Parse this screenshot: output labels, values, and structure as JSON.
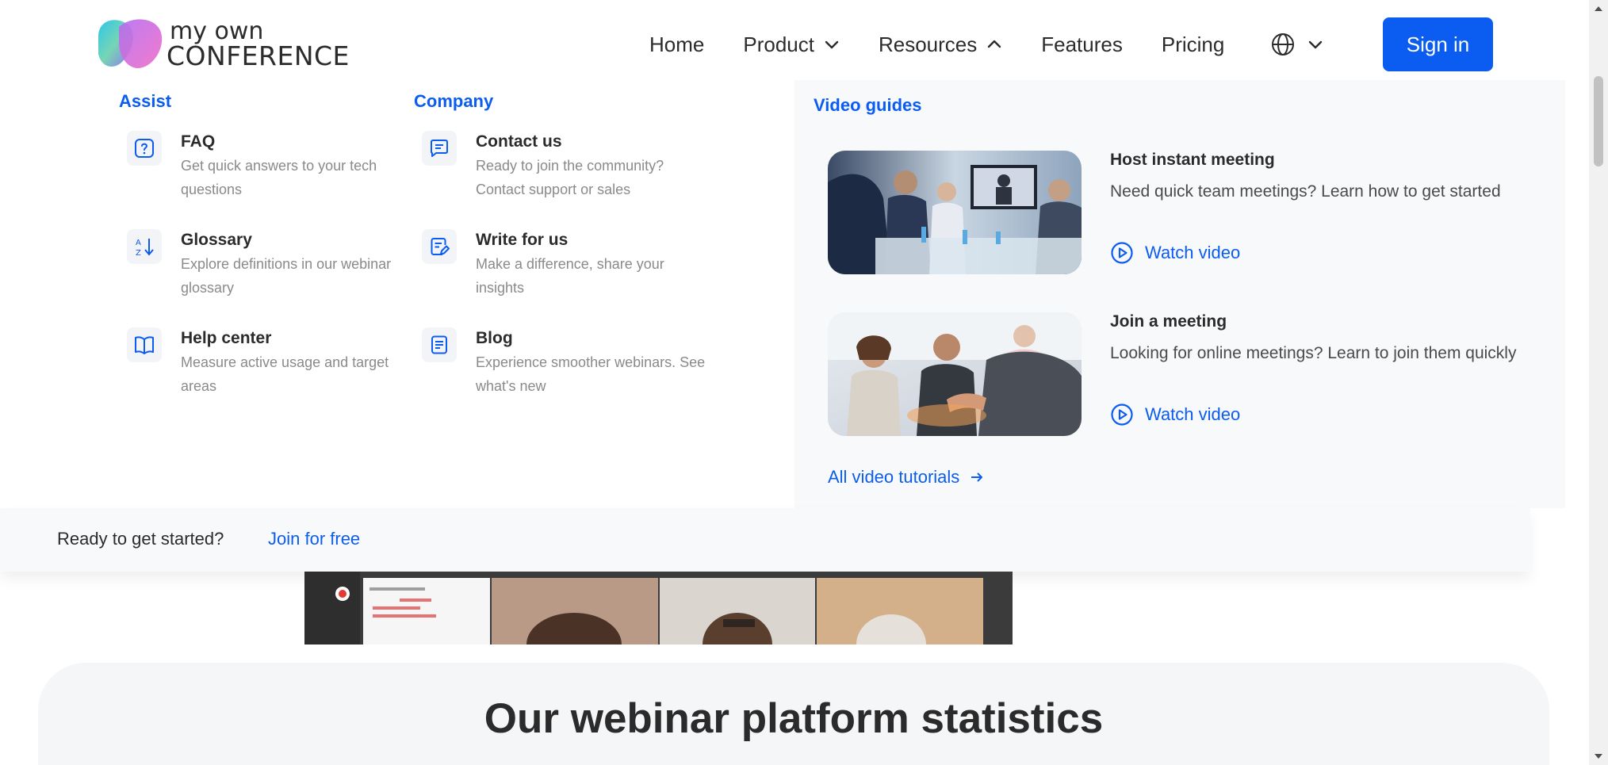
{
  "logo": {
    "line1": "my own",
    "line2": "CONFERENCE"
  },
  "nav": {
    "items": [
      {
        "label": "Home"
      },
      {
        "label": "Product"
      },
      {
        "label": "Resources"
      },
      {
        "label": "Features"
      },
      {
        "label": "Pricing"
      }
    ],
    "signin_label": "Sign in"
  },
  "menu": {
    "assist": {
      "heading": "Assist",
      "items": [
        {
          "title": "FAQ",
          "desc": "Get quick answers to your tech questions",
          "icon": "question-icon"
        },
        {
          "title": "Glossary",
          "desc": "Explore definitions in our webinar glossary",
          "icon": "sort-az-icon"
        },
        {
          "title": "Help center",
          "desc": "Measure active usage and target areas",
          "icon": "book-icon"
        }
      ]
    },
    "company": {
      "heading": "Company",
      "items": [
        {
          "title": "Contact us",
          "desc": "Ready to join the community? Contact support or sales",
          "icon": "chat-icon"
        },
        {
          "title": "Write for us",
          "desc": "Make a difference, share your insights",
          "icon": "edit-document-icon"
        },
        {
          "title": "Blog",
          "desc": "Experience smoother webinars. See what's new",
          "icon": "document-icon"
        }
      ]
    },
    "videos": {
      "heading": "Video guides",
      "items": [
        {
          "title": "Host instant meeting",
          "desc": "Need quick team meetings? Learn how to get started",
          "action": "Watch video"
        },
        {
          "title": "Join a meeting",
          "desc": "Looking for online meetings? Learn to join them quickly",
          "action": "Watch video"
        }
      ],
      "all_label": "All video tutorials"
    }
  },
  "cta": {
    "text": "Ready to get started?",
    "link": "Join for free"
  },
  "stats": {
    "title": "Our webinar platform statistics"
  },
  "colors": {
    "accent": "#0b5cf0",
    "text": "#2b2b2b",
    "muted": "#8a8a8a",
    "panel": "#f8f9fb"
  }
}
